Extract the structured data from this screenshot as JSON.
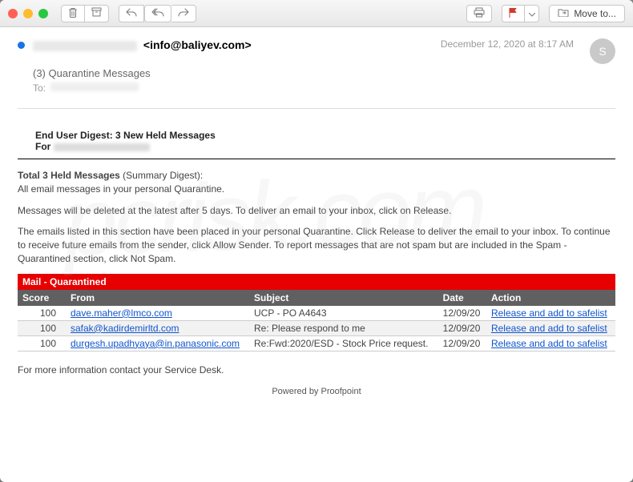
{
  "toolbar": {
    "move_to_label": "Move to..."
  },
  "email": {
    "sender_email": "<info@baliyev.com>",
    "date": "December 12, 2020 at 8:17 AM",
    "avatar_initial": "S",
    "subject": "(3) Quarantine Messages",
    "to_label": "To:"
  },
  "digest": {
    "title": "End User Digest: 3 New Held Messages",
    "for_label": "For"
  },
  "body": {
    "summary_label": "Total 3 Held Messages",
    "summary_suffix": " (Summary Digest):",
    "summary_line2": "All email messages in your personal Quarantine.",
    "deletion_note": "Messages will be deleted at the latest after 5 days. To deliver an email to your inbox, click on Release.",
    "explanation": "The emails listed in this section have been placed in your personal Quarantine. Click Release to deliver the email to your inbox. To continue to receive future emails from the sender, click Allow Sender. To report messages that are not spam but are included in the Spam - Quarantined section, click Not Spam.",
    "footer_info": "For more information contact your Service Desk.",
    "powered_by": "Powered by Proofpoint"
  },
  "table": {
    "section_title": "Mail - Quarantined",
    "cols": {
      "score": "Score",
      "from": "From",
      "subject": "Subject",
      "date": "Date",
      "action": "Action"
    },
    "rows": [
      {
        "score": "100",
        "from": "dave.maher@lmco.com",
        "subject": "UCP - PO A4643",
        "date": "12/09/20",
        "action": "Release and add to safelist"
      },
      {
        "score": "100",
        "from": "safak@kadirdemirltd.com",
        "subject": "Re: Please respond to me",
        "date": "12/09/20",
        "action": "Release and add to safelist"
      },
      {
        "score": "100",
        "from": "durgesh.upadhyaya@in.panasonic.com",
        "subject": "Re:Fwd:2020/ESD - Stock Price request.",
        "date": "12/09/20",
        "action": "Release and add to safelist"
      }
    ]
  },
  "watermark": "pcrisk.com"
}
